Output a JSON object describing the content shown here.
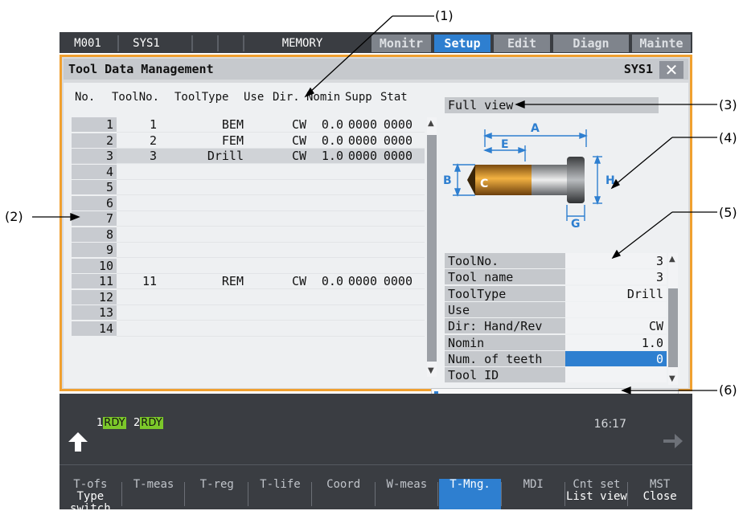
{
  "callouts": [
    "(1)",
    "(2)",
    "(3)",
    "(4)",
    "(5)",
    "(6)"
  ],
  "status_bar": {
    "program": "M001",
    "system": "SYS1",
    "mode": "MEMORY",
    "tabs": [
      "Monitr",
      "Setup",
      "Edit",
      "Diagn",
      "Mainte"
    ],
    "active_tab": "Setup"
  },
  "window": {
    "title": "Tool Data Management",
    "system": "SYS1",
    "close_glyph": "✕"
  },
  "tool_list": {
    "headers": [
      "No.",
      "ToolNo.",
      "ToolType",
      "Use",
      "Dir.",
      "Nomin",
      "Supp",
      "Stat"
    ],
    "rows": [
      {
        "no": "1",
        "tool_no": "1",
        "tool_type": "BEM",
        "use": "",
        "dir": "CW",
        "nomin": "0.0",
        "supp": "0000",
        "stat": "0000"
      },
      {
        "no": "2",
        "tool_no": "2",
        "tool_type": "FEM",
        "use": "",
        "dir": "CW",
        "nomin": "0.0",
        "supp": "0000",
        "stat": "0000"
      },
      {
        "no": "3",
        "tool_no": "3",
        "tool_type": "Drill",
        "use": "",
        "dir": "CW",
        "nomin": "1.0",
        "supp": "0000",
        "stat": "0000"
      },
      {
        "no": "4",
        "tool_no": "",
        "tool_type": "",
        "use": "",
        "dir": "",
        "nomin": "",
        "supp": "",
        "stat": ""
      },
      {
        "no": "5",
        "tool_no": "",
        "tool_type": "",
        "use": "",
        "dir": "",
        "nomin": "",
        "supp": "",
        "stat": ""
      },
      {
        "no": "6",
        "tool_no": "",
        "tool_type": "",
        "use": "",
        "dir": "",
        "nomin": "",
        "supp": "",
        "stat": ""
      },
      {
        "no": "7",
        "tool_no": "",
        "tool_type": "",
        "use": "",
        "dir": "",
        "nomin": "",
        "supp": "",
        "stat": ""
      },
      {
        "no": "8",
        "tool_no": "",
        "tool_type": "",
        "use": "",
        "dir": "",
        "nomin": "",
        "supp": "",
        "stat": ""
      },
      {
        "no": "9",
        "tool_no": "",
        "tool_type": "",
        "use": "",
        "dir": "",
        "nomin": "",
        "supp": "",
        "stat": ""
      },
      {
        "no": "10",
        "tool_no": "",
        "tool_type": "",
        "use": "",
        "dir": "",
        "nomin": "",
        "supp": "",
        "stat": ""
      },
      {
        "no": "11",
        "tool_no": "11",
        "tool_type": "REM",
        "use": "",
        "dir": "CW",
        "nomin": "0.0",
        "supp": "0000",
        "stat": "0000"
      },
      {
        "no": "12",
        "tool_no": "",
        "tool_type": "",
        "use": "",
        "dir": "",
        "nomin": "",
        "supp": "",
        "stat": ""
      },
      {
        "no": "13",
        "tool_no": "",
        "tool_type": "",
        "use": "",
        "dir": "",
        "nomin": "",
        "supp": "",
        "stat": ""
      },
      {
        "no": "14",
        "tool_no": "",
        "tool_type": "",
        "use": "",
        "dir": "",
        "nomin": "",
        "supp": "",
        "stat": ""
      }
    ],
    "selected_row": "3"
  },
  "full_view": {
    "title": "Full view",
    "dimension_labels": [
      "A",
      "E",
      "B",
      "C",
      "H",
      "G"
    ]
  },
  "properties": [
    {
      "key": "ToolNo.",
      "value": "3"
    },
    {
      "key": "Tool name",
      "value": "3"
    },
    {
      "key": "ToolType",
      "value": "Drill"
    },
    {
      "key": "Use",
      "value": ""
    },
    {
      "key": "Dir: Hand/Rev",
      "value": "CW"
    },
    {
      "key": "Nomin",
      "value": "1.0"
    },
    {
      "key": "Num. of teeth",
      "value": "0",
      "highlight": true
    },
    {
      "key": "Tool ID",
      "value": ""
    }
  ],
  "input": {
    "value": ""
  },
  "bottom": {
    "rdy": [
      {
        "index": "1",
        "label": "RDY"
      },
      {
        "index": "2",
        "label": "RDY"
      }
    ],
    "clock": "16:17",
    "function_keys": [
      {
        "label": "T-ofs",
        "sub": "Type switch"
      },
      {
        "label": "T-meas",
        "sub": ""
      },
      {
        "label": "T-reg",
        "sub": ""
      },
      {
        "label": "T-life",
        "sub": ""
      },
      {
        "label": "Coord",
        "sub": ""
      },
      {
        "label": "W-meas",
        "sub": ""
      },
      {
        "label": "T-Mng.",
        "sub": "",
        "active": true
      },
      {
        "label": "MDI",
        "sub": ""
      },
      {
        "label": "Cnt set",
        "sub": "List view"
      },
      {
        "label": "MST",
        "sub": "Close"
      }
    ]
  },
  "colors": {
    "accent": "#2e7fd0",
    "frame": "#f0a030",
    "rdy": "#7cc82a"
  }
}
